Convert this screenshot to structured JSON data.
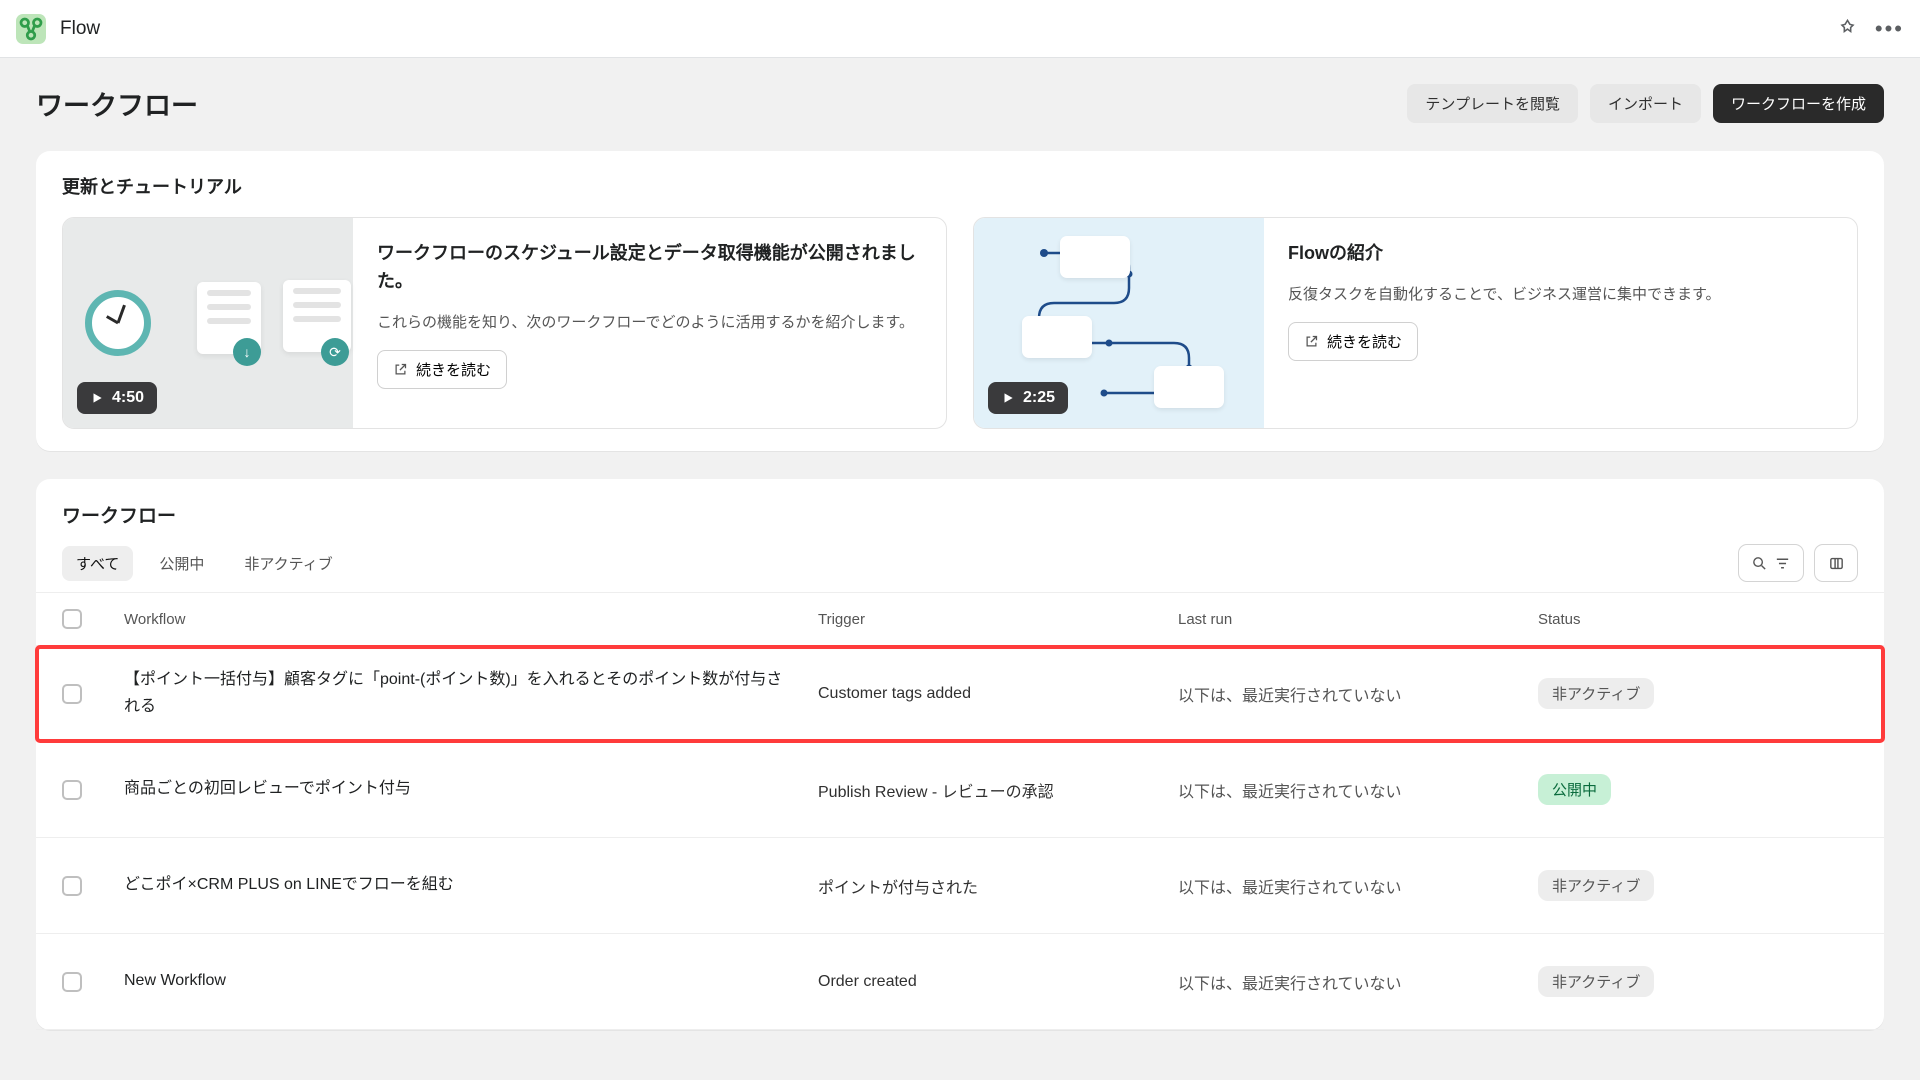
{
  "app": {
    "name": "Flow"
  },
  "page": {
    "title": "ワークフロー",
    "buttons": {
      "templates": "テンプレートを閲覧",
      "import": "インポート",
      "create": "ワークフローを作成"
    }
  },
  "tutorials_section": {
    "title": "更新とチュートリアル",
    "cards": [
      {
        "duration": "4:50",
        "title": "ワークフローのスケジュール設定とデータ取得機能が公開されました。",
        "desc": "これらの機能を知り、次のワークフローでどのように活用するかを紹介します。",
        "readmore": "続きを読む"
      },
      {
        "duration": "2:25",
        "title": "Flowの紹介",
        "desc": "反復タスクを自動化することで、ビジネス運営に集中できます。",
        "readmore": "続きを読む"
      }
    ]
  },
  "workflows_section": {
    "title": "ワークフロー",
    "tabs": {
      "all": "すべて",
      "published": "公開中",
      "inactive": "非アクティブ"
    },
    "columns": {
      "workflow": "Workflow",
      "trigger": "Trigger",
      "lastrun": "Last run",
      "status": "Status"
    },
    "status_labels": {
      "inactive": "非アクティブ",
      "active": "公開中"
    },
    "rows": [
      {
        "name": "【ポイント一括付与】顧客タグに「point-(ポイント数)」を入れるとそのポイント数が付与される",
        "trigger": "Customer tags added",
        "lastrun": "以下は、最近実行されていない",
        "status": "inactive",
        "highlight": true
      },
      {
        "name": "商品ごとの初回レビューでポイント付与",
        "trigger": "Publish Review - レビューの承認",
        "lastrun": "以下は、最近実行されていない",
        "status": "active",
        "highlight": false
      },
      {
        "name": "どこポイ×CRM PLUS on LINEでフローを組む",
        "trigger": "ポイントが付与された",
        "lastrun": "以下は、最近実行されていない",
        "status": "inactive",
        "highlight": false
      },
      {
        "name": "New Workflow",
        "trigger": "Order created",
        "lastrun": "以下は、最近実行されていない",
        "status": "inactive",
        "highlight": false
      }
    ]
  }
}
